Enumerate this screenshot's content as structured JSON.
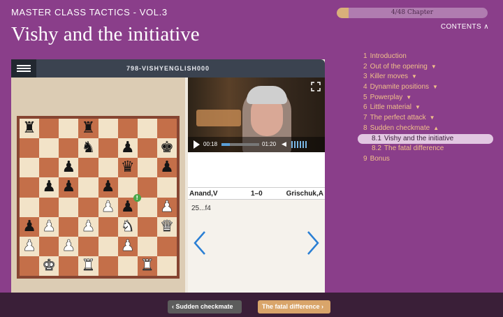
{
  "header": {
    "series_title": "MASTER CLASS TACTICS - VOL.3",
    "chapter_title": "Vishy and the initiative",
    "progress_label": "4/48 Chapter",
    "progress_fraction": 0.08,
    "contents_label": "CONTENTS"
  },
  "toc": {
    "items": [
      {
        "num": "1",
        "label": "Introduction",
        "arrow": ""
      },
      {
        "num": "2",
        "label": "Out of the opening",
        "arrow": "▼"
      },
      {
        "num": "3",
        "label": "Killer moves",
        "arrow": "▼"
      },
      {
        "num": "4",
        "label": "Dynamite positions",
        "arrow": "▼"
      },
      {
        "num": "5",
        "label": "Powerplay",
        "arrow": "▼"
      },
      {
        "num": "6",
        "label": "Little material",
        "arrow": "▼"
      },
      {
        "num": "7",
        "label": "The perfect attack",
        "arrow": "▼"
      },
      {
        "num": "8",
        "label": "Sudden checkmate",
        "arrow": "▲"
      },
      {
        "num": "8.1",
        "label": "Vishy and the initiative",
        "arrow": "",
        "sub": true,
        "active": true
      },
      {
        "num": "8.2",
        "label": "The fatal difference",
        "arrow": "",
        "sub": true
      },
      {
        "num": "9",
        "label": "Bonus",
        "arrow": ""
      }
    ]
  },
  "viewer": {
    "game_id": "798-VISHYENGLISH000",
    "board_rows": [
      [
        "bR",
        "",
        "",
        "bR",
        "",
        "",
        "",
        ""
      ],
      [
        "",
        "",
        "",
        "bN",
        "",
        "bP",
        "",
        "bK"
      ],
      [
        "",
        "",
        "bP",
        "",
        "",
        "bQ",
        "",
        "bP"
      ],
      [
        "",
        "bP",
        "bP",
        "",
        "bP",
        "",
        "",
        ""
      ],
      [
        "",
        "",
        "",
        "",
        "wP",
        "bP",
        "",
        "wP"
      ],
      [
        "bP",
        "wP",
        "",
        "wP",
        "",
        "wN",
        "",
        "wQ"
      ],
      [
        "wP",
        "",
        "wP",
        "",
        "",
        "wP",
        "",
        ""
      ],
      [
        "",
        "wK",
        "",
        "wR",
        "",
        "",
        "wR",
        ""
      ]
    ],
    "video": {
      "current_time": "00:18",
      "total_time": "01:20",
      "progress_fraction": 0.22
    },
    "game": {
      "white": "Anand,V",
      "result": "1–0",
      "black": "Grischuk,A",
      "move": "25...f4"
    }
  },
  "footer": {
    "prev_label": "Sudden checkmate",
    "next_label": "The fatal difference"
  },
  "colors": {
    "background": "#8a3e8a",
    "accent": "#d9a56a",
    "toc_text": "#f1c08a",
    "board_dark": "#c46f49",
    "board_light": "#f2e3c8"
  }
}
